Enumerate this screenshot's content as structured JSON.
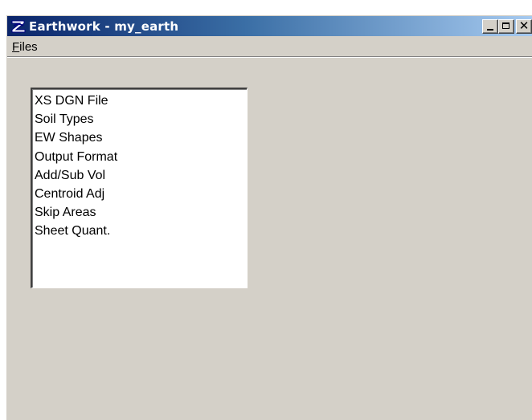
{
  "window": {
    "title": "Earthwork - my_earth",
    "app_icon": "earthwork-logo-icon",
    "controls": {
      "minimize": "minimize-icon",
      "maximize": "maximize-icon",
      "close_glyph": "✕"
    }
  },
  "menu": {
    "files_label_underlined": "F",
    "files_label_rest": "iles"
  },
  "list": {
    "items": [
      "XS DGN File",
      "Soil Types",
      "EW Shapes",
      "Output Format",
      "Add/Sub Vol",
      "Centroid Adj",
      "Skip Areas",
      "Sheet Quant."
    ]
  },
  "colors": {
    "titlebar_start": "#0a246a",
    "titlebar_end": "#a6caf0",
    "window_face": "#d4d0c8",
    "list_background": "#ffffff"
  }
}
